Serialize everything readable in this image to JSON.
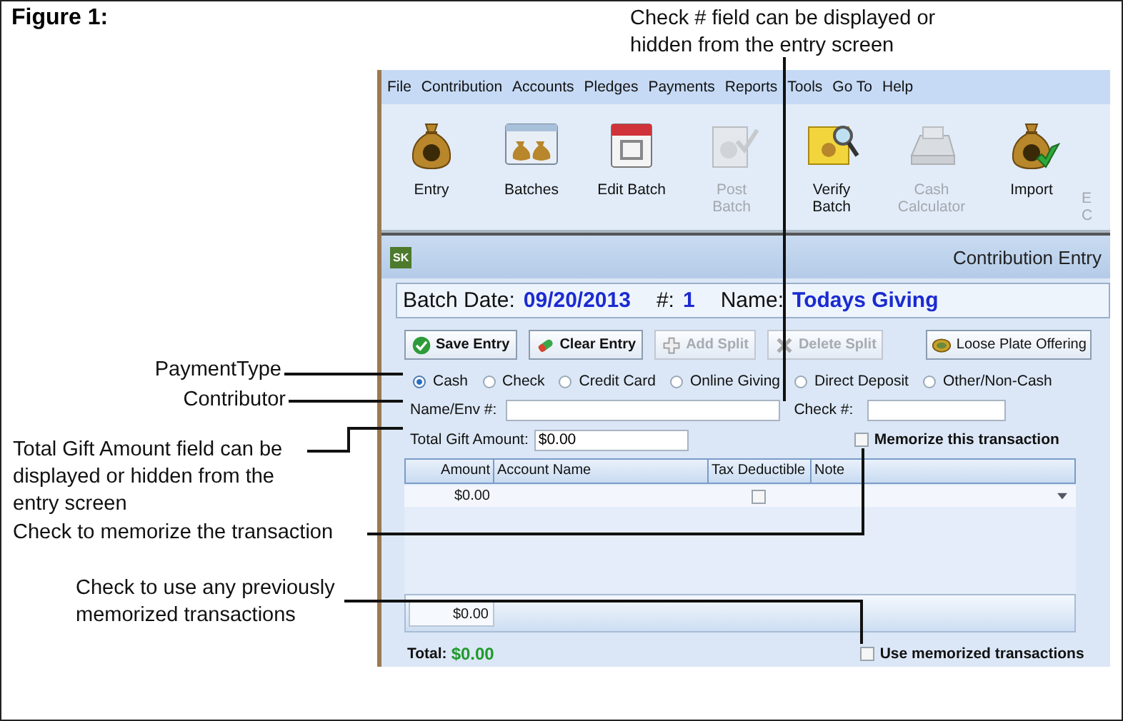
{
  "figure": {
    "title": "Figure 1:"
  },
  "callouts": [
    "Check # field can be displayed or hidden from the entry screen",
    "PaymentType",
    "Contributor",
    "Total Gift Amount field can be displayed or hidden from the entry screen",
    "Check to memorize the transaction",
    "Check to use any previously memorized transactions"
  ],
  "app": {
    "menu": [
      "File",
      "Contribution",
      "Accounts",
      "Pledges",
      "Payments",
      "Reports",
      "Tools",
      "Go To",
      "Help"
    ],
    "toolbar": [
      {
        "label": "Entry",
        "disabled": false
      },
      {
        "label": "Batches",
        "disabled": false
      },
      {
        "label": "Edit Batch",
        "disabled": false
      },
      {
        "label": "Post Batch",
        "disabled": true
      },
      {
        "label": "Verify Batch",
        "disabled": false
      },
      {
        "label": "Cash Calculator",
        "disabled": true
      },
      {
        "label": "Import",
        "disabled": false
      },
      {
        "label": "E C",
        "disabled": true
      }
    ],
    "window": {
      "badge": "SK",
      "title": "Contribution Entry"
    },
    "batch": {
      "date_label": "Batch Date:",
      "date": "09/20/2013",
      "number_label": "#:",
      "number": "1",
      "name_label": "Name:",
      "name": "Todays Giving"
    },
    "buttons": [
      {
        "label": "Save Entry",
        "disabled": false
      },
      {
        "label": "Clear Entry",
        "disabled": false
      },
      {
        "label": "Add Split",
        "disabled": true
      },
      {
        "label": "Delete Split",
        "disabled": true
      },
      {
        "label": "Loose Plate Offering",
        "disabled": false
      }
    ],
    "payment_types": [
      {
        "label": "Cash",
        "selected": true
      },
      {
        "label": "Check",
        "selected": false
      },
      {
        "label": "Credit Card",
        "selected": false
      },
      {
        "label": "Online Giving",
        "selected": false
      },
      {
        "label": "Direct Deposit",
        "selected": false
      },
      {
        "label": "Other/Non-Cash",
        "selected": false
      }
    ],
    "name_field": {
      "label": "Name/Env #:"
    },
    "check_field": {
      "label": "Check #:"
    },
    "total_gift": {
      "label": "Total Gift Amount:",
      "value": "$0.00"
    },
    "memorize": {
      "label": "Memorize this transaction",
      "checked": false
    },
    "grid": {
      "columns": [
        "Amount",
        "Account Name",
        "Tax Deductible",
        "Note"
      ],
      "rows": [
        {
          "amount": "$0.00",
          "tax_deductible": false
        }
      ],
      "footer_total": "$0.00"
    },
    "total": {
      "label": "Total:",
      "value": "$0.00"
    },
    "use_memorized": {
      "label": "Use memorized transactions",
      "checked": false
    }
  }
}
